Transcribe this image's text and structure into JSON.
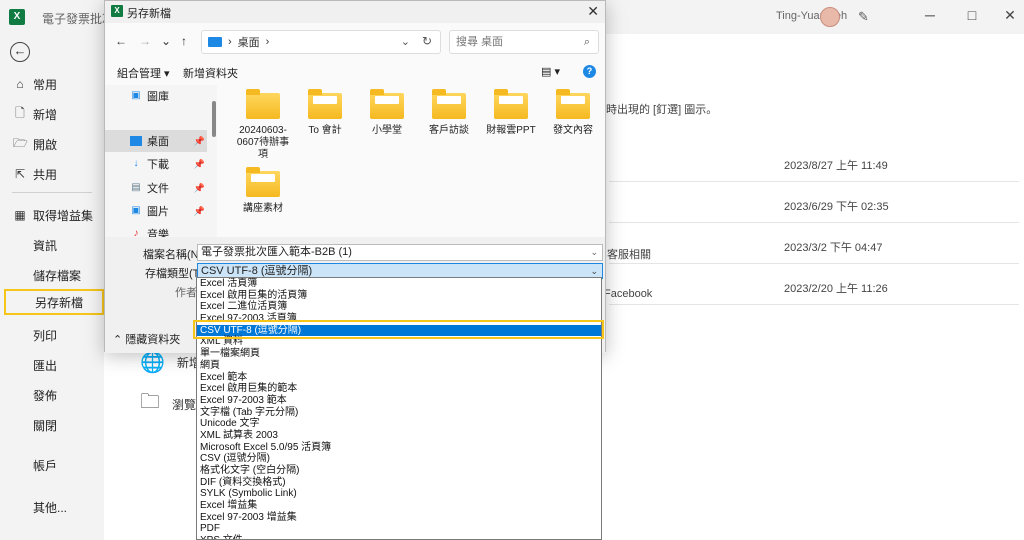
{
  "app": {
    "doc_title": "電子發票批次匯",
    "user_name": "Ting-Yuan Yeh"
  },
  "nav": {
    "items": [
      {
        "label": "常用",
        "icon": "⌂"
      },
      {
        "label": "新增",
        "icon": "🗋"
      },
      {
        "label": "開啟",
        "icon": "🗁"
      },
      {
        "label": "共用",
        "icon": "⇱"
      },
      {
        "label": "取得增益集",
        "icon": "▦"
      },
      {
        "label": "資訊"
      },
      {
        "label": "儲存檔案"
      },
      {
        "label": "另存新檔",
        "selected": true
      },
      {
        "label": "列印"
      },
      {
        "label": "匯出"
      },
      {
        "label": "發佈"
      },
      {
        "label": "關閉"
      },
      {
        "label": "帳戶"
      },
      {
        "label": "其他..."
      }
    ]
  },
  "background": {
    "pin_hint": "時出現的 [釘選] 圖示。",
    "row_text_2": "客服相關",
    "row_text_3": "Facebook",
    "dates": [
      "2023/8/27 上午 11:49",
      "2023/6/29 下午 02:35",
      "2023/3/2 下午 04:47",
      "2023/2/20 上午 11:26"
    ],
    "add_place": "新增",
    "browse": "瀏覽"
  },
  "dialog": {
    "title": "另存新檔",
    "breadcrumb": "桌面",
    "breadcrumb_sep": "›",
    "search_placeholder": "搜尋 桌面",
    "organize": "組合管理",
    "new_folder": "新增資料夾",
    "left_items": [
      {
        "label": "圖庫",
        "icon": "picture-icon"
      },
      {
        "label": "桌面",
        "icon": "desktop-icon",
        "selected": true
      },
      {
        "label": "下載",
        "icon": "download-icon"
      },
      {
        "label": "文件",
        "icon": "document-icon"
      },
      {
        "label": "圖片",
        "icon": "picture-icon"
      },
      {
        "label": "音樂",
        "icon": "music-icon"
      }
    ],
    "files": [
      {
        "name": "20240603-0607待辦事項"
      },
      {
        "name": "To 會計"
      },
      {
        "name": "小學堂"
      },
      {
        "name": "客戶訪談"
      },
      {
        "name": "財報雲PPT"
      },
      {
        "name": "發文內容"
      },
      {
        "name": "講座素材"
      }
    ],
    "filename_label": "檔案名稱(N):",
    "filename_value": "電子發票批次匯入範本-B2B (1)",
    "filetype_label": "存檔類型(T):",
    "filetype_value": "CSV UTF-8 (逗號分隔)",
    "author_label": "作者",
    "hide_folders": "隱藏資料夾"
  },
  "type_list": {
    "selected_index": 4,
    "items": [
      "Excel 活頁簿",
      "Excel 啟用巨集的活頁簿",
      "Excel 二進位活頁簿",
      "Excel 97-2003 活頁簿",
      "CSV UTF-8 (逗號分隔)",
      "XML 資料",
      "單一檔案網頁",
      "網頁",
      "Excel 範本",
      "Excel 啟用巨集的範本",
      "Excel 97-2003 範本",
      "文字檔 (Tab 字元分隔)",
      "Unicode 文字",
      "XML 試算表 2003",
      "Microsoft Excel 5.0/95 活頁簿",
      "CSV (逗號分隔)",
      "格式化文字 (空白分隔)",
      "DIF (資料交換格式)",
      "SYLK (Symbolic Link)",
      "Excel 增益集",
      "Excel 97-2003 增益集",
      "PDF",
      "XPS 文件"
    ]
  },
  "colors": {
    "highlight": "#f5c518",
    "selection": "#0078d7",
    "excel_green": "#107c41"
  }
}
